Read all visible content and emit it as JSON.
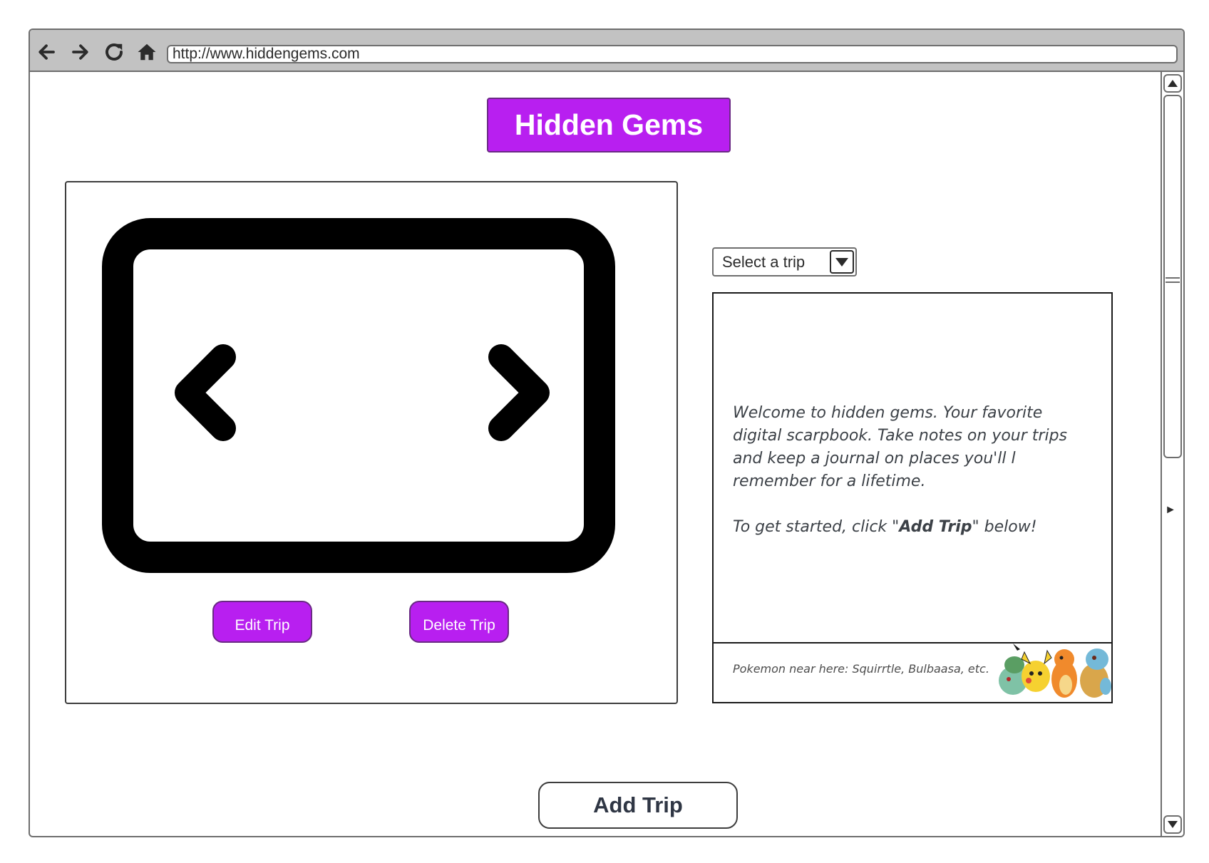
{
  "browser": {
    "url": "http://www.hiddengems.com",
    "nav_icons": [
      "back-arrow-icon",
      "forward-arrow-icon",
      "reload-icon",
      "home-icon"
    ]
  },
  "header": {
    "title": "Hidden Gems",
    "accent_color": "#b81ff0"
  },
  "gallery": {
    "icons": [
      "carousel-frame-icon",
      "chevron-left-icon",
      "chevron-right-icon"
    ],
    "edit_label": "Edit Trip",
    "delete_label": "Delete Trip"
  },
  "trip_select": {
    "selected": "Select a trip"
  },
  "info": {
    "welcome": "Welcome to hidden gems. Your favorite digital scarpbook. Take notes on  your trips and keep a journal on places you'll l remember for a lifetime.",
    "cta_prefix": "To get started, click \"",
    "cta_bold": "Add Trip",
    "cta_suffix": "\" below!",
    "pokemon_note": "Pokemon  near here: Squirrtle, Bulbaasa, etc."
  },
  "footer": {
    "add_trip_label": "Add Trip"
  }
}
